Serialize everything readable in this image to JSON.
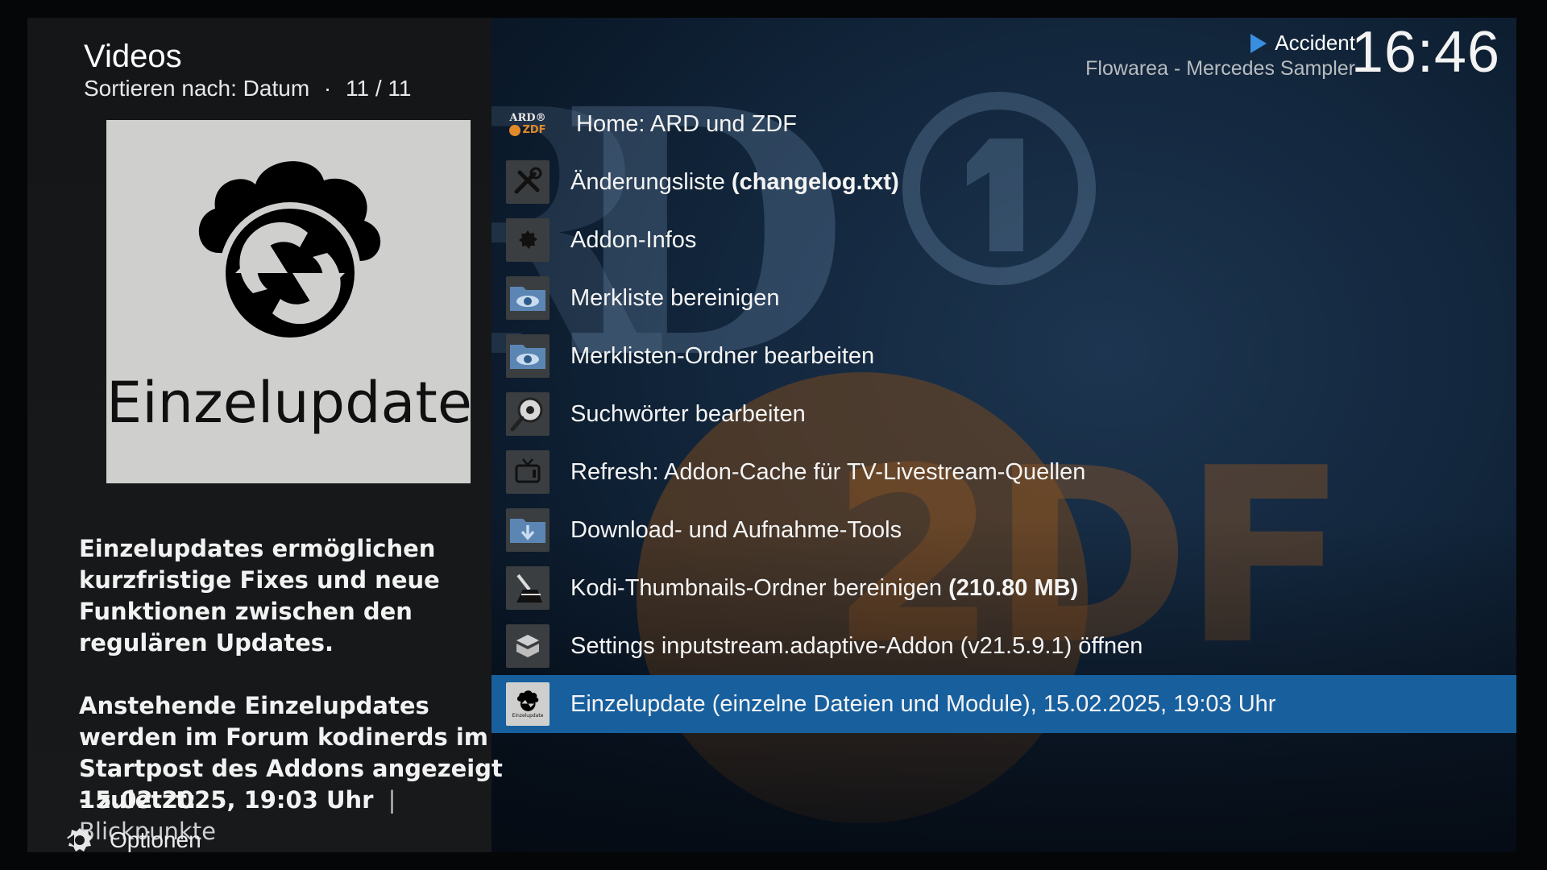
{
  "header": {
    "title": "Videos",
    "sort_text": "Sortieren nach: Datum",
    "separator": "·",
    "count": "11 / 11"
  },
  "now_playing": {
    "title": "Accident",
    "subtitle": "Flowarea - Mercedes Sampler",
    "icon": "play-icon"
  },
  "clock": "16:46",
  "thumbnail": {
    "label": "Einzelupdate",
    "icon": "cloud-sync-icon"
  },
  "plot": {
    "paragraph1": "Einzelupdates ermöglichen kurzfristige Fixes und neue Funktionen zwischen den regulären Updates.",
    "paragraph2": "Anstehende Einzelupdates werden im Forum kodinerds im Startpost des Addons angezeigt - zuletzt:",
    "date": "15.02.2025, 19:03 Uhr",
    "separator": "|",
    "tag": "Blickpunkte"
  },
  "options": {
    "label": "Optionen",
    "icon": "options-icon"
  },
  "list": {
    "items": [
      {
        "label": "Home: ARD und ZDF",
        "bold": "",
        "icon": "ard-zdf-logo"
      },
      {
        "label": "Änderungsliste ",
        "bold": "(changelog.txt)",
        "icon": "tools-icon"
      },
      {
        "label": "Addon-Infos",
        "bold": "",
        "icon": "gear-icon"
      },
      {
        "label": "Merkliste bereinigen",
        "bold": "",
        "icon": "folder-eye-icon"
      },
      {
        "label": "Merklisten-Ordner bearbeiten",
        "bold": "",
        "icon": "folder-eye-icon"
      },
      {
        "label": "Suchwörter bearbeiten",
        "bold": "",
        "icon": "magnifier-icon"
      },
      {
        "label": "Refresh: Addon-Cache für TV-Livestream-Quellen",
        "bold": "",
        "icon": "tv-icon"
      },
      {
        "label": "Download- und Aufnahme-Tools",
        "bold": "",
        "icon": "folder-download-icon"
      },
      {
        "label": "Kodi-Thumbnails-Ordner bereinigen ",
        "bold": "(210.80 MB)",
        "icon": "broom-icon"
      },
      {
        "label": "Settings inputstream.adaptive-Addon (v21.5.9.1) öffnen",
        "bold": "",
        "icon": "box-icon"
      },
      {
        "label": "Einzelupdate (einzelne Dateien und Module), 15.02.2025, 19:03 Uhr",
        "bold": "",
        "icon": "cloud-sync-icon",
        "selected": true
      }
    ]
  },
  "icon_texts": {
    "ard": "ARD®",
    "zdf": "ZDF"
  },
  "colors": {
    "selection": "#185f9e",
    "accent": "#3a8ee0"
  }
}
